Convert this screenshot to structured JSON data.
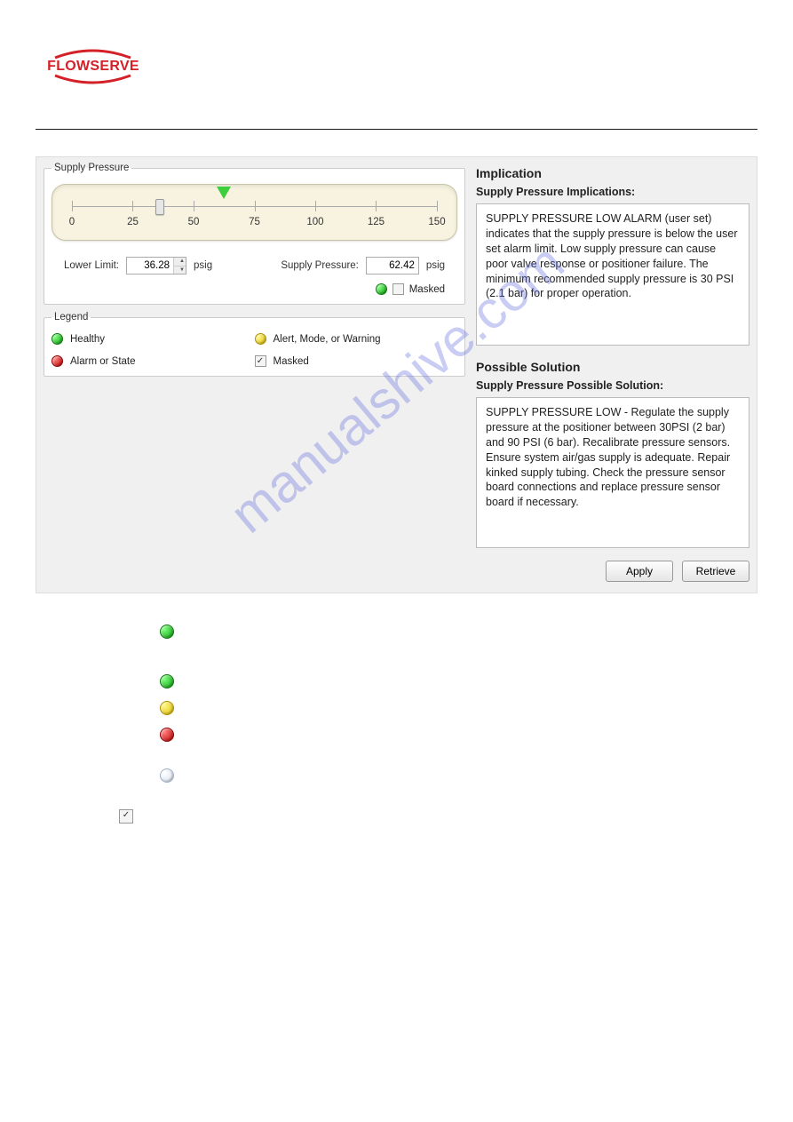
{
  "logo_text": "FLOWSERVE",
  "watermark": "manualshive.com",
  "gauge": {
    "fieldset_title": "Supply Pressure",
    "ticks": [
      0,
      25,
      50,
      75,
      100,
      125,
      150
    ],
    "min": 0,
    "max": 150,
    "handle_value": 36.28,
    "marker_value": 62.42,
    "lower_limit_label": "Lower Limit:",
    "lower_limit_value": "36.28",
    "lower_limit_unit": "psig",
    "supply_label": "Supply Pressure:",
    "supply_value": "62.42",
    "supply_unit": "psig",
    "masked_label": "Masked"
  },
  "legend": {
    "title": "Legend",
    "healthy": "Healthy",
    "alert": "Alert, Mode, or Warning",
    "alarm": "Alarm or State",
    "masked": "Masked"
  },
  "implication": {
    "heading": "Implication",
    "sub": "Supply Pressure Implications:",
    "body": "SUPPLY PRESSURE LOW ALARM (user set) indicates that the supply pressure is below the user set alarm limit.  Low supply pressure can cause poor valve response or positioner failure.  The minimum recommended supply pressure is 30 PSI (2.1 bar) for proper operation."
  },
  "solution": {
    "heading": "Possible Solution",
    "sub": "Supply Pressure Possible Solution:",
    "body": "SUPPLY PRESSURE LOW - Regulate the supply pressure at the positioner between 30PSI (2 bar) and 90 PSI (6 bar).  Recalibrate pressure sensors.  Ensure system air/gas supply is adequate.  Repair kinked supply tubing.  Check the pressure sensor board connections and replace pressure sensor board if necessary."
  },
  "buttons": {
    "apply": "Apply",
    "retrieve": "Retrieve"
  }
}
